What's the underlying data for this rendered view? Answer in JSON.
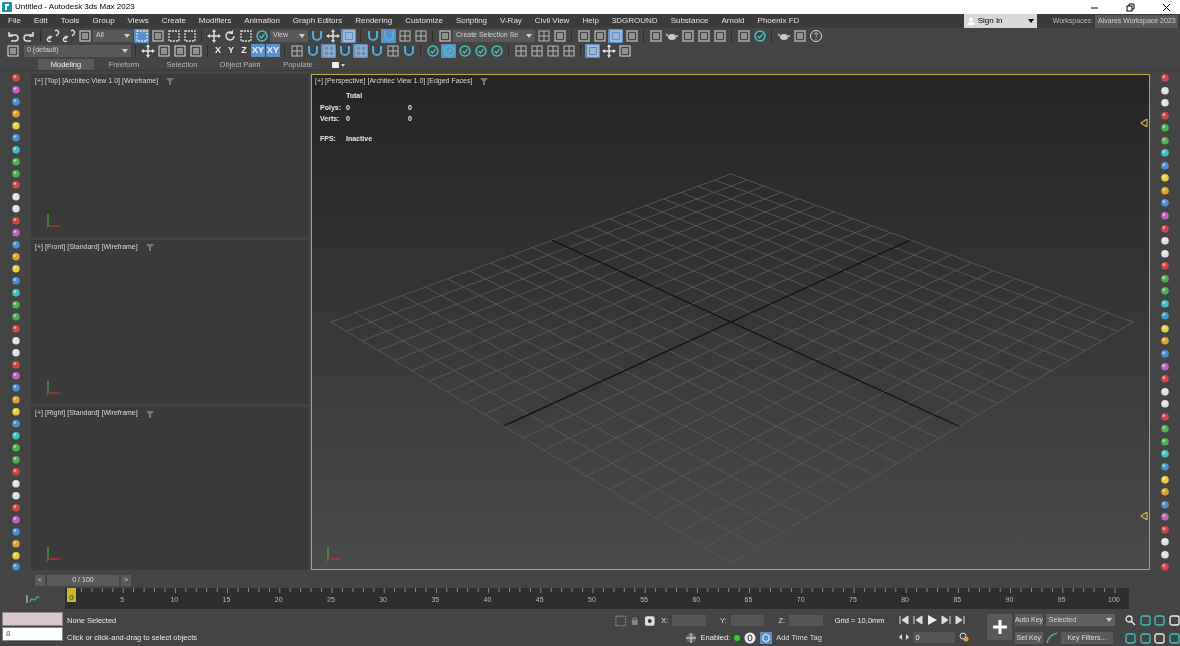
{
  "window": {
    "title": "Untitled - Autodesk 3ds Max 2023"
  },
  "menu": [
    "File",
    "Edit",
    "Tools",
    "Group",
    "Views",
    "Create",
    "Modifiers",
    "Animation",
    "Graph Editors",
    "Rendering",
    "Customize",
    "Scripting",
    "V-Ray",
    "Civil View",
    "Help",
    "3DGROUND",
    "Substance",
    "Arnold",
    "Phoenix FD"
  ],
  "sign_in": {
    "label": "Sign In"
  },
  "workspaces": {
    "label": "Workspaces:",
    "value": "Alvares Workspace 2023"
  },
  "toolbar": {
    "selection_filter": "All",
    "reference_coord": "View",
    "named_selection": "Create Selection Se",
    "layer": "0 (default)",
    "axis_buttons": [
      {
        "label": "X",
        "selected": false
      },
      {
        "label": "Y",
        "selected": false
      },
      {
        "label": "Z",
        "selected": false
      },
      {
        "label": "XY",
        "selected": true
      },
      {
        "label": "XY",
        "selected": true
      }
    ]
  },
  "ribbon_tabs": [
    {
      "label": "Modeling",
      "selected": true
    },
    {
      "label": "Freeform",
      "selected": false
    },
    {
      "label": "Selection",
      "selected": false
    },
    {
      "label": "Object Paint",
      "selected": false
    },
    {
      "label": "Populate",
      "selected": false
    }
  ],
  "viewports": [
    {
      "labels": [
        "[+]",
        "[Top]",
        "[Architec View 1.0]",
        "[Wireframe]"
      ],
      "active": false
    },
    {
      "labels": [
        "[+]",
        "[Front]",
        "[Standard]",
        "[Wireframe]"
      ],
      "active": false
    },
    {
      "labels": [
        "[+]",
        "[Right]",
        "[Standard]",
        "[Wireframe]"
      ],
      "active": false
    },
    {
      "labels": [
        "[+]",
        "[Perspective]",
        "[Architec View 1.0]",
        "[Edged Faces]"
      ],
      "active": true,
      "stats": {
        "header": "Total",
        "rows": [
          {
            "label": "Polys:",
            "value": "0",
            "total": "0"
          },
          {
            "label": "Verts:",
            "value": "0",
            "total": "0"
          }
        ],
        "fps_label": "FPS:",
        "fps": "Inactive"
      }
    }
  ],
  "time_slider": {
    "label": "0 / 100",
    "level": 0,
    "prev": "<",
    "next": ">"
  },
  "timeline": {
    "current": "0",
    "ticks": [
      "5",
      "10",
      "15",
      "20",
      "25",
      "30",
      "35",
      "40",
      "45",
      "50",
      "55",
      "60",
      "65",
      "70",
      "75",
      "80",
      "85",
      "90",
      "95",
      "100"
    ]
  },
  "status": {
    "maxscript_value": "8",
    "selection": "None Selected",
    "prompt": "Click or click-and-drag to select objects",
    "x_label": "X:",
    "y_label": "Y:",
    "z_label": "Z:",
    "grid": "Grid = 10,0mm",
    "enabled_label": "Enabled:",
    "enabled": true,
    "time_tag": "Add Time Tag",
    "frame": "0",
    "auto_key": "Auto Key",
    "key_mode": "Selected",
    "set_key": "Set Key",
    "key_filters": "Key Filters..."
  }
}
